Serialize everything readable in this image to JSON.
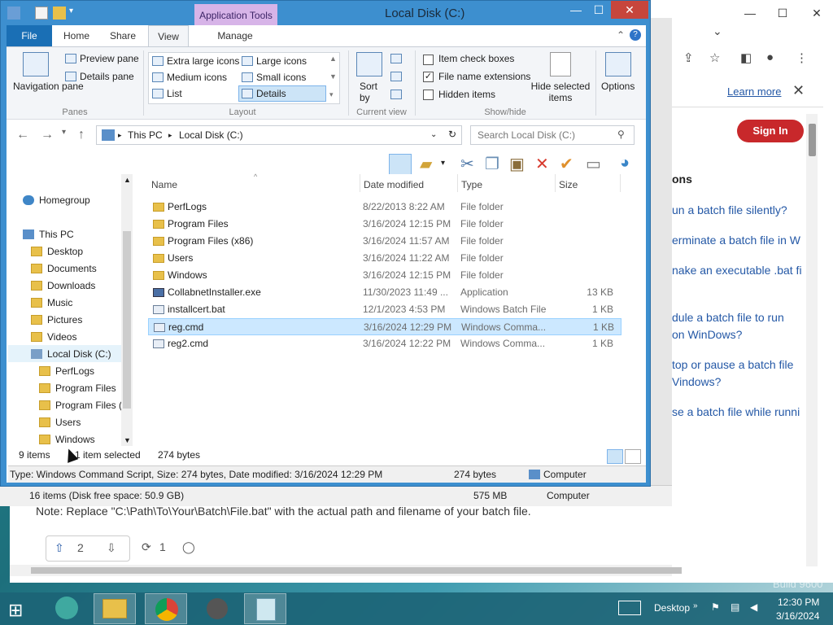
{
  "window": {
    "title": "Local Disk (C:)",
    "app_tools": "Application Tools"
  },
  "tabs": [
    "File",
    "Home",
    "Share",
    "View",
    "Manage"
  ],
  "ribbon": {
    "panes": {
      "navigation_pane": "Navigation pane",
      "preview_pane": "Preview pane",
      "details_pane": "Details pane",
      "group": "Panes"
    },
    "layout": {
      "items": [
        "Extra large icons",
        "Large icons",
        "Medium icons",
        "Small icons",
        "List",
        "Details"
      ],
      "selected": "Details",
      "group": "Layout"
    },
    "current_view": {
      "sort_by": "Sort by",
      "group": "Current view"
    },
    "show_hide": {
      "item_check_boxes": "Item check boxes",
      "file_name_extensions": "File name extensions",
      "hidden_items": "Hidden items",
      "hide_selected_items": "Hide selected items",
      "group": "Show/hide",
      "checked": {
        "item_check_boxes": false,
        "file_name_extensions": true,
        "hidden_items": false
      }
    },
    "options": "Options"
  },
  "address": {
    "crumbs": [
      "This PC",
      "Local Disk (C:)"
    ],
    "search_placeholder": "Search Local Disk (C:)"
  },
  "nav": {
    "homegroup": "Homegroup",
    "this_pc": "This PC",
    "pc_items": [
      "Desktop",
      "Documents",
      "Downloads",
      "Music",
      "Pictures",
      "Videos",
      "Local Disk (C:)"
    ],
    "disk_items": [
      "PerfLogs",
      "Program Files",
      "Program Files (",
      "Users",
      "Windows"
    ]
  },
  "columns": [
    "Name",
    "Date modified",
    "Type",
    "Size"
  ],
  "files": [
    {
      "name": "PerfLogs",
      "date": "8/22/2013 8:22 AM",
      "type": "File folder",
      "size": "",
      "icon": "folder-icon"
    },
    {
      "name": "Program Files",
      "date": "3/16/2024 12:15 PM",
      "type": "File folder",
      "size": "",
      "icon": "folder-icon"
    },
    {
      "name": "Program Files (x86)",
      "date": "3/16/2024 11:57 AM",
      "type": "File folder",
      "size": "",
      "icon": "folder-icon"
    },
    {
      "name": "Users",
      "date": "3/16/2024 11:22 AM",
      "type": "File folder",
      "size": "",
      "icon": "folder-icon"
    },
    {
      "name": "Windows",
      "date": "3/16/2024 12:15 PM",
      "type": "File folder",
      "size": "",
      "icon": "folder-icon"
    },
    {
      "name": "CollabnetInstaller.exe",
      "date": "11/30/2023 11:49 ...",
      "type": "Application",
      "size": "13 KB",
      "icon": "app-icon"
    },
    {
      "name": "installcert.bat",
      "date": "12/1/2023 4:53 PM",
      "type": "Windows Batch File",
      "size": "1 KB",
      "icon": "script-icon"
    },
    {
      "name": "reg.cmd",
      "date": "3/16/2024 12:29 PM",
      "type": "Windows Comma...",
      "size": "1 KB",
      "icon": "script-icon"
    },
    {
      "name": "reg2.cmd",
      "date": "3/16/2024 12:22 PM",
      "type": "Windows Comma...",
      "size": "1 KB",
      "icon": "script-icon"
    }
  ],
  "selected_file": "reg.cmd",
  "status": {
    "count": "9 items",
    "selected": "1 item selected",
    "bytes": "274 bytes"
  },
  "details": {
    "info": "Type: Windows Command Script, Size: 274 bytes, Date modified: 3/16/2024 12:29 PM",
    "size": "274 bytes",
    "location": "Computer"
  },
  "explorer2": {
    "info": "16 items (Disk free space: 50.9 GB)",
    "size": "575 MB",
    "location": "Computer"
  },
  "browser": {
    "learn_more": "Learn more",
    "sign_in": "Sign In",
    "section_head": "ons",
    "questions": [
      "un a batch file silently?",
      "erminate a batch file in W",
      "nake an executable .bat fi",
      "dule a batch file to run",
      "on WinDows?",
      "top or pause a batch file",
      "Vindows?",
      "se a batch file while runni"
    ],
    "note": "Note: Replace \"C:\\Path\\To\\Your\\Batch\\File.bat\" with the actual path and filename of your batch file.",
    "upvotes": "2",
    "reposts": "1"
  },
  "taskbar": {
    "desktop": "Desktop",
    "time": "12:30 PM",
    "date": "3/16/2024",
    "build": "Build 9600"
  }
}
